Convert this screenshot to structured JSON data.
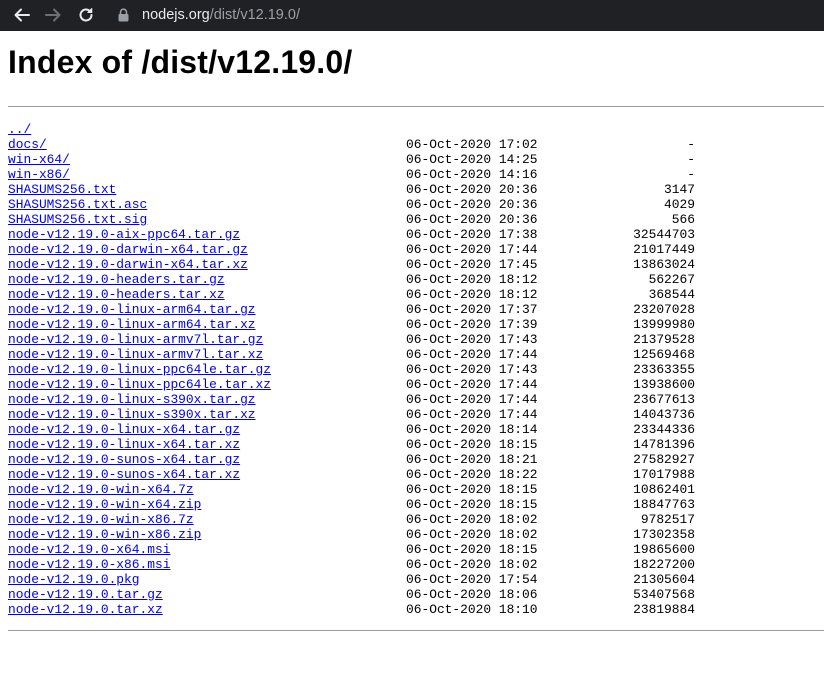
{
  "browser": {
    "url_host": "nodejs.org",
    "url_path": "/dist/v12.19.0/",
    "back_icon": "arrow-left-icon",
    "forward_icon": "arrow-right-icon",
    "reload_icon": "reload-icon",
    "lock_icon": "lock-icon"
  },
  "page": {
    "title": "Index of /dist/v12.19.0/"
  },
  "entries": [
    {
      "name": "../",
      "date": "",
      "size": ""
    },
    {
      "name": "docs/",
      "date": "06-Oct-2020 17:02",
      "size": "-"
    },
    {
      "name": "win-x64/",
      "date": "06-Oct-2020 14:25",
      "size": "-"
    },
    {
      "name": "win-x86/",
      "date": "06-Oct-2020 14:16",
      "size": "-"
    },
    {
      "name": "SHASUMS256.txt",
      "date": "06-Oct-2020 20:36",
      "size": "3147"
    },
    {
      "name": "SHASUMS256.txt.asc",
      "date": "06-Oct-2020 20:36",
      "size": "4029"
    },
    {
      "name": "SHASUMS256.txt.sig",
      "date": "06-Oct-2020 20:36",
      "size": "566"
    },
    {
      "name": "node-v12.19.0-aix-ppc64.tar.gz",
      "date": "06-Oct-2020 17:38",
      "size": "32544703"
    },
    {
      "name": "node-v12.19.0-darwin-x64.tar.gz",
      "date": "06-Oct-2020 17:44",
      "size": "21017449"
    },
    {
      "name": "node-v12.19.0-darwin-x64.tar.xz",
      "date": "06-Oct-2020 17:45",
      "size": "13863024"
    },
    {
      "name": "node-v12.19.0-headers.tar.gz",
      "date": "06-Oct-2020 18:12",
      "size": "562267"
    },
    {
      "name": "node-v12.19.0-headers.tar.xz",
      "date": "06-Oct-2020 18:12",
      "size": "368544"
    },
    {
      "name": "node-v12.19.0-linux-arm64.tar.gz",
      "date": "06-Oct-2020 17:37",
      "size": "23207028"
    },
    {
      "name": "node-v12.19.0-linux-arm64.tar.xz",
      "date": "06-Oct-2020 17:39",
      "size": "13999980"
    },
    {
      "name": "node-v12.19.0-linux-armv7l.tar.gz",
      "date": "06-Oct-2020 17:43",
      "size": "21379528"
    },
    {
      "name": "node-v12.19.0-linux-armv7l.tar.xz",
      "date": "06-Oct-2020 17:44",
      "size": "12569468"
    },
    {
      "name": "node-v12.19.0-linux-ppc64le.tar.gz",
      "date": "06-Oct-2020 17:43",
      "size": "23363355"
    },
    {
      "name": "node-v12.19.0-linux-ppc64le.tar.xz",
      "date": "06-Oct-2020 17:44",
      "size": "13938600"
    },
    {
      "name": "node-v12.19.0-linux-s390x.tar.gz",
      "date": "06-Oct-2020 17:44",
      "size": "23677613"
    },
    {
      "name": "node-v12.19.0-linux-s390x.tar.xz",
      "date": "06-Oct-2020 17:44",
      "size": "14043736"
    },
    {
      "name": "node-v12.19.0-linux-x64.tar.gz",
      "date": "06-Oct-2020 18:14",
      "size": "23344336"
    },
    {
      "name": "node-v12.19.0-linux-x64.tar.xz",
      "date": "06-Oct-2020 18:15",
      "size": "14781396"
    },
    {
      "name": "node-v12.19.0-sunos-x64.tar.gz",
      "date": "06-Oct-2020 18:21",
      "size": "27582927"
    },
    {
      "name": "node-v12.19.0-sunos-x64.tar.xz",
      "date": "06-Oct-2020 18:22",
      "size": "17017988"
    },
    {
      "name": "node-v12.19.0-win-x64.7z",
      "date": "06-Oct-2020 18:15",
      "size": "10862401"
    },
    {
      "name": "node-v12.19.0-win-x64.zip",
      "date": "06-Oct-2020 18:15",
      "size": "18847763"
    },
    {
      "name": "node-v12.19.0-win-x86.7z",
      "date": "06-Oct-2020 18:02",
      "size": "9782517"
    },
    {
      "name": "node-v12.19.0-win-x86.zip",
      "date": "06-Oct-2020 18:02",
      "size": "17302358"
    },
    {
      "name": "node-v12.19.0-x64.msi",
      "date": "06-Oct-2020 18:15",
      "size": "19865600"
    },
    {
      "name": "node-v12.19.0-x86.msi",
      "date": "06-Oct-2020 18:02",
      "size": "18227200"
    },
    {
      "name": "node-v12.19.0.pkg",
      "date": "06-Oct-2020 17:54",
      "size": "21305604"
    },
    {
      "name": "node-v12.19.0.tar.gz",
      "date": "06-Oct-2020 18:06",
      "size": "53407568"
    },
    {
      "name": "node-v12.19.0.tar.xz",
      "date": "06-Oct-2020 18:10",
      "size": "23819884"
    }
  ],
  "colors": {
    "toolbar": "#202124",
    "link": "#0000ee",
    "rule": "#9b9b9b"
  }
}
